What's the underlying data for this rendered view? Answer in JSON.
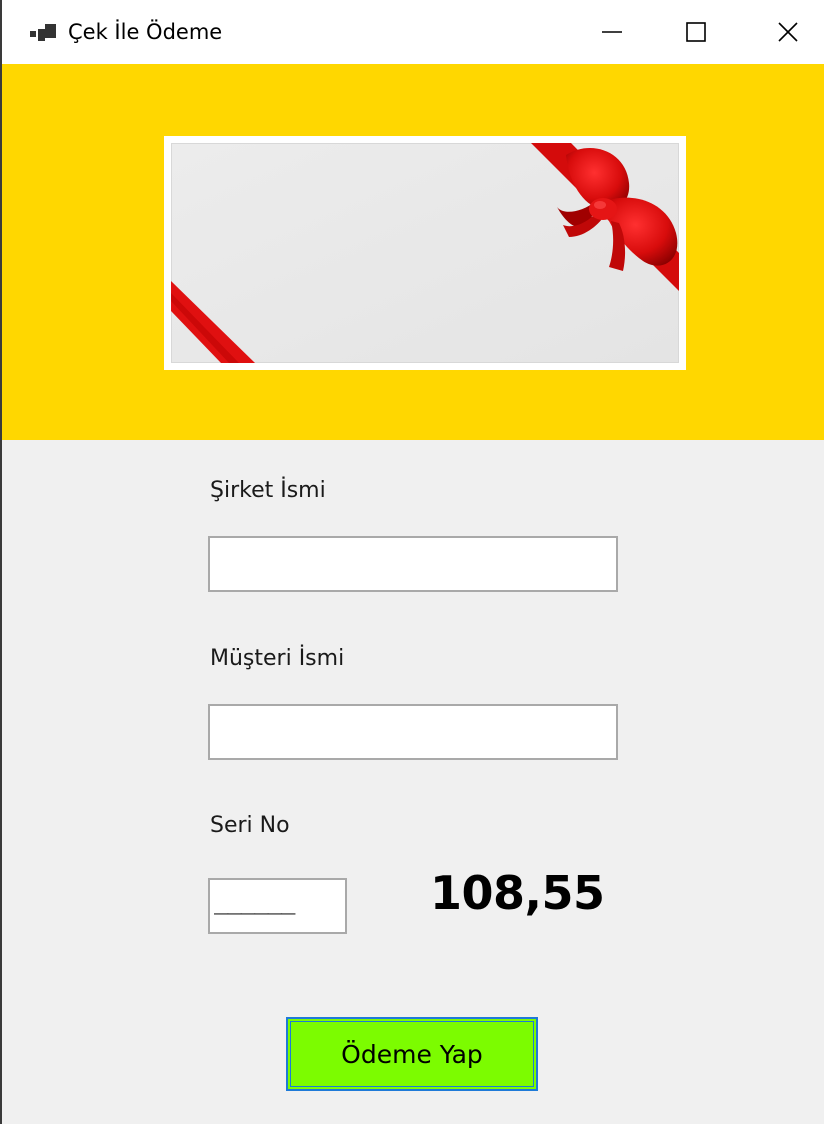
{
  "window": {
    "title": "Çek İle Ödeme"
  },
  "form": {
    "company_label": "Şirket İsmi",
    "company_value": "",
    "customer_label": "Müşteri İsmi",
    "customer_value": "",
    "serial_label": "Seri No",
    "serial_value": "______",
    "amount": "108,55",
    "pay_button_label": "Ödeme Yap"
  },
  "icons": {
    "app": "app-icon",
    "minimize": "minimize-icon",
    "maximize": "maximize-icon",
    "close": "close-icon"
  },
  "colors": {
    "banner": "#ffd700",
    "pay_button": "#7cfc00",
    "pay_button_border": "#1e7ad8",
    "ribbon": "#e01010"
  }
}
